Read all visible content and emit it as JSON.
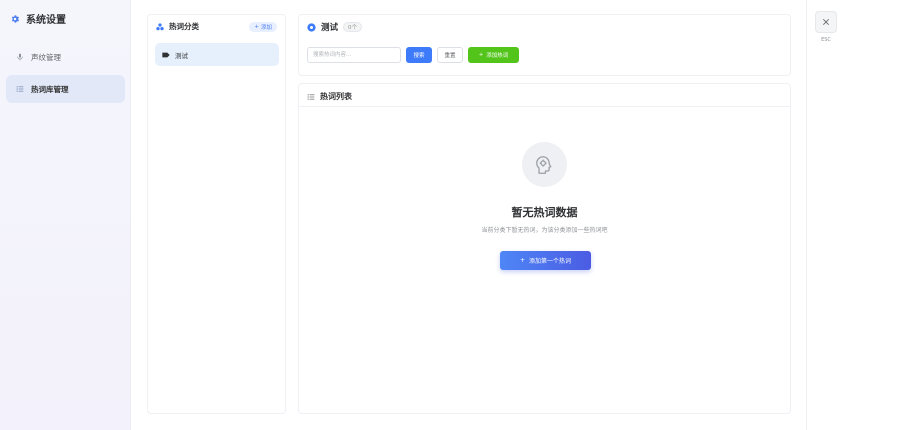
{
  "sidebar": {
    "title": "系统设置",
    "items": [
      {
        "label": "声纹管理",
        "icon": "microphone-icon",
        "active": false
      },
      {
        "label": "热词库管理",
        "icon": "list-icon",
        "active": true
      }
    ]
  },
  "category_panel": {
    "title": "热词分类",
    "add_label": "添加",
    "items": [
      {
        "label": "测试",
        "icon": "tag-icon"
      }
    ]
  },
  "hotword_panel": {
    "title": "测试",
    "count": "0个",
    "search": {
      "placeholder": "搜索热词内容...",
      "value": ""
    },
    "search_button": "搜索",
    "reset_button": "重置",
    "add_button": "添加热词"
  },
  "list_panel": {
    "title": "热词列表",
    "empty_title": "暂无热词数据",
    "empty_desc": "当前分类下暂无热词，为该分类添加一些热词吧",
    "empty_button": "添加第一个热词"
  },
  "close": {
    "label": "ESC"
  },
  "colors": {
    "primary": "#3e7bfa",
    "success": "#52c41a",
    "gradient_start": "#4e86f6",
    "gradient_end": "#4b5ce3"
  }
}
